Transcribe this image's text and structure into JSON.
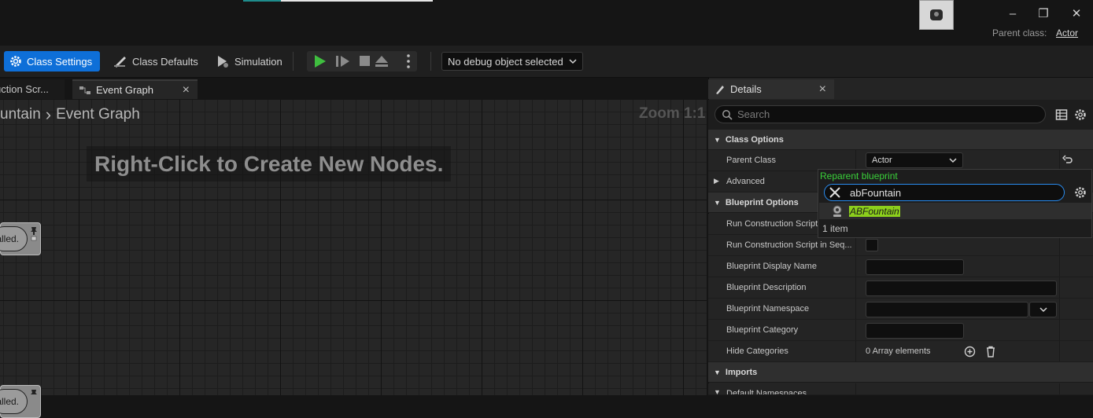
{
  "window": {
    "parent_class_label": "Parent class:",
    "parent_class_value": "Actor",
    "minimize": "–",
    "maximize": "❐",
    "close": "✕"
  },
  "toolbar": {
    "class_settings": "Class Settings",
    "class_defaults": "Class Defaults",
    "simulation": "Simulation",
    "debug_object": "No debug object selected"
  },
  "tabs": {
    "construction": "uction Scr...",
    "event_graph": "Event Graph",
    "close": "×"
  },
  "graph": {
    "breadcrumb_parent": "untain",
    "breadcrumb_sep": "›",
    "breadcrumb_current": "Event Graph",
    "zoom": "Zoom 1:1",
    "hint": "Right-Click to Create New Nodes.",
    "node1_text": "alled.",
    "node2_text": "alled."
  },
  "details": {
    "tab_label": "Details",
    "close": "×",
    "search_placeholder": "Search",
    "categories": {
      "class_options": "Class Options",
      "blueprint_options": "Blueprint Options",
      "imports": "Imports"
    },
    "rows": {
      "parent_class": "Parent Class",
      "parent_class_value": "Actor",
      "advanced": "Advanced",
      "run_construction": "Run Construction Script",
      "run_construction_seq": "Run Construction Script in Seq...",
      "display_name": "Blueprint Display Name",
      "description": "Blueprint Description",
      "namespace": "Blueprint Namespace",
      "category": "Blueprint Category",
      "hide_categories": "Hide Categories",
      "hide_categories_value": "0 Array elements",
      "default_namespaces": "Default Namespaces"
    }
  },
  "popup": {
    "title": "Reparent blueprint",
    "search_value": "abFountain",
    "result": "ABFountain",
    "count": "1 item"
  },
  "colors": {
    "accent_blue": "#0e6fd8",
    "play_green": "#3fbe3f",
    "popup_title_green": "#3ad13a",
    "highlight": "#8ccf1c"
  }
}
